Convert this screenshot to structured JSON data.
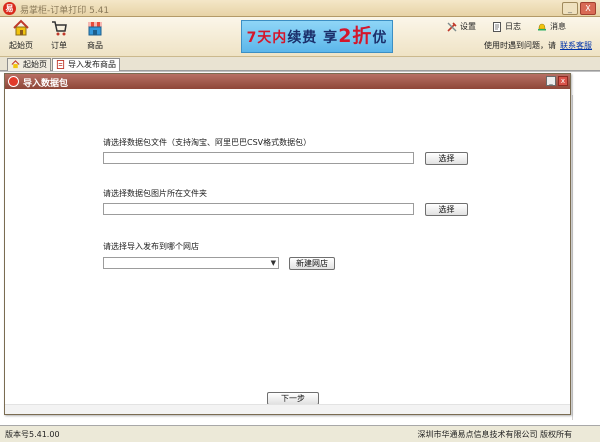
{
  "window": {
    "title": "易掌柜-订单打印 5.41",
    "app_icon_glyph": "易",
    "minimize_glyph": "_",
    "close_glyph": "X"
  },
  "toolbar": {
    "items": [
      {
        "label": "起始页",
        "icon": "home-icon"
      },
      {
        "label": "订单",
        "icon": "cart-icon"
      },
      {
        "label": "商品",
        "icon": "store-icon"
      }
    ],
    "banner": {
      "part1": "7天内",
      "part2": "续费 享",
      "part3": "2折",
      "part4": "优惠"
    },
    "settings_label": "设置",
    "log_label": "日志",
    "message_label": "消息",
    "help_text": "使用时遇到问题，请",
    "help_link": "联系客服"
  },
  "tabs": [
    {
      "label": "起始页",
      "icon": "home-icon",
      "active": false
    },
    {
      "label": "导入发布商品",
      "icon": "document-icon",
      "active": true
    }
  ],
  "background": {
    "link_fragment": "程"
  },
  "dialog": {
    "title": "导入数据包",
    "field1_label": "请选择数据包文件（支持淘宝、阿里巴巴CSV格式数据包）",
    "field1_value": "",
    "field1_button": "选择",
    "field2_label": "请选择数据包图片所在文件夹",
    "field2_value": "",
    "field2_button": "选择",
    "field3_label": "请选择导入发布到哪个网店",
    "field3_value": "",
    "new_shop_button": "新建网店",
    "next_button": "下一步",
    "minimize_glyph": "_",
    "close_glyph": "x"
  },
  "statusbar": {
    "version": "版本号5.41.00",
    "copyright": "深圳市华通易点信息技术有限公司 版权所有"
  },
  "colors": {
    "accent_red": "#d92a1c",
    "link_blue": "#0033aa",
    "banner_blue": "#5cb6ea",
    "dialog_title": "#8e4638"
  }
}
